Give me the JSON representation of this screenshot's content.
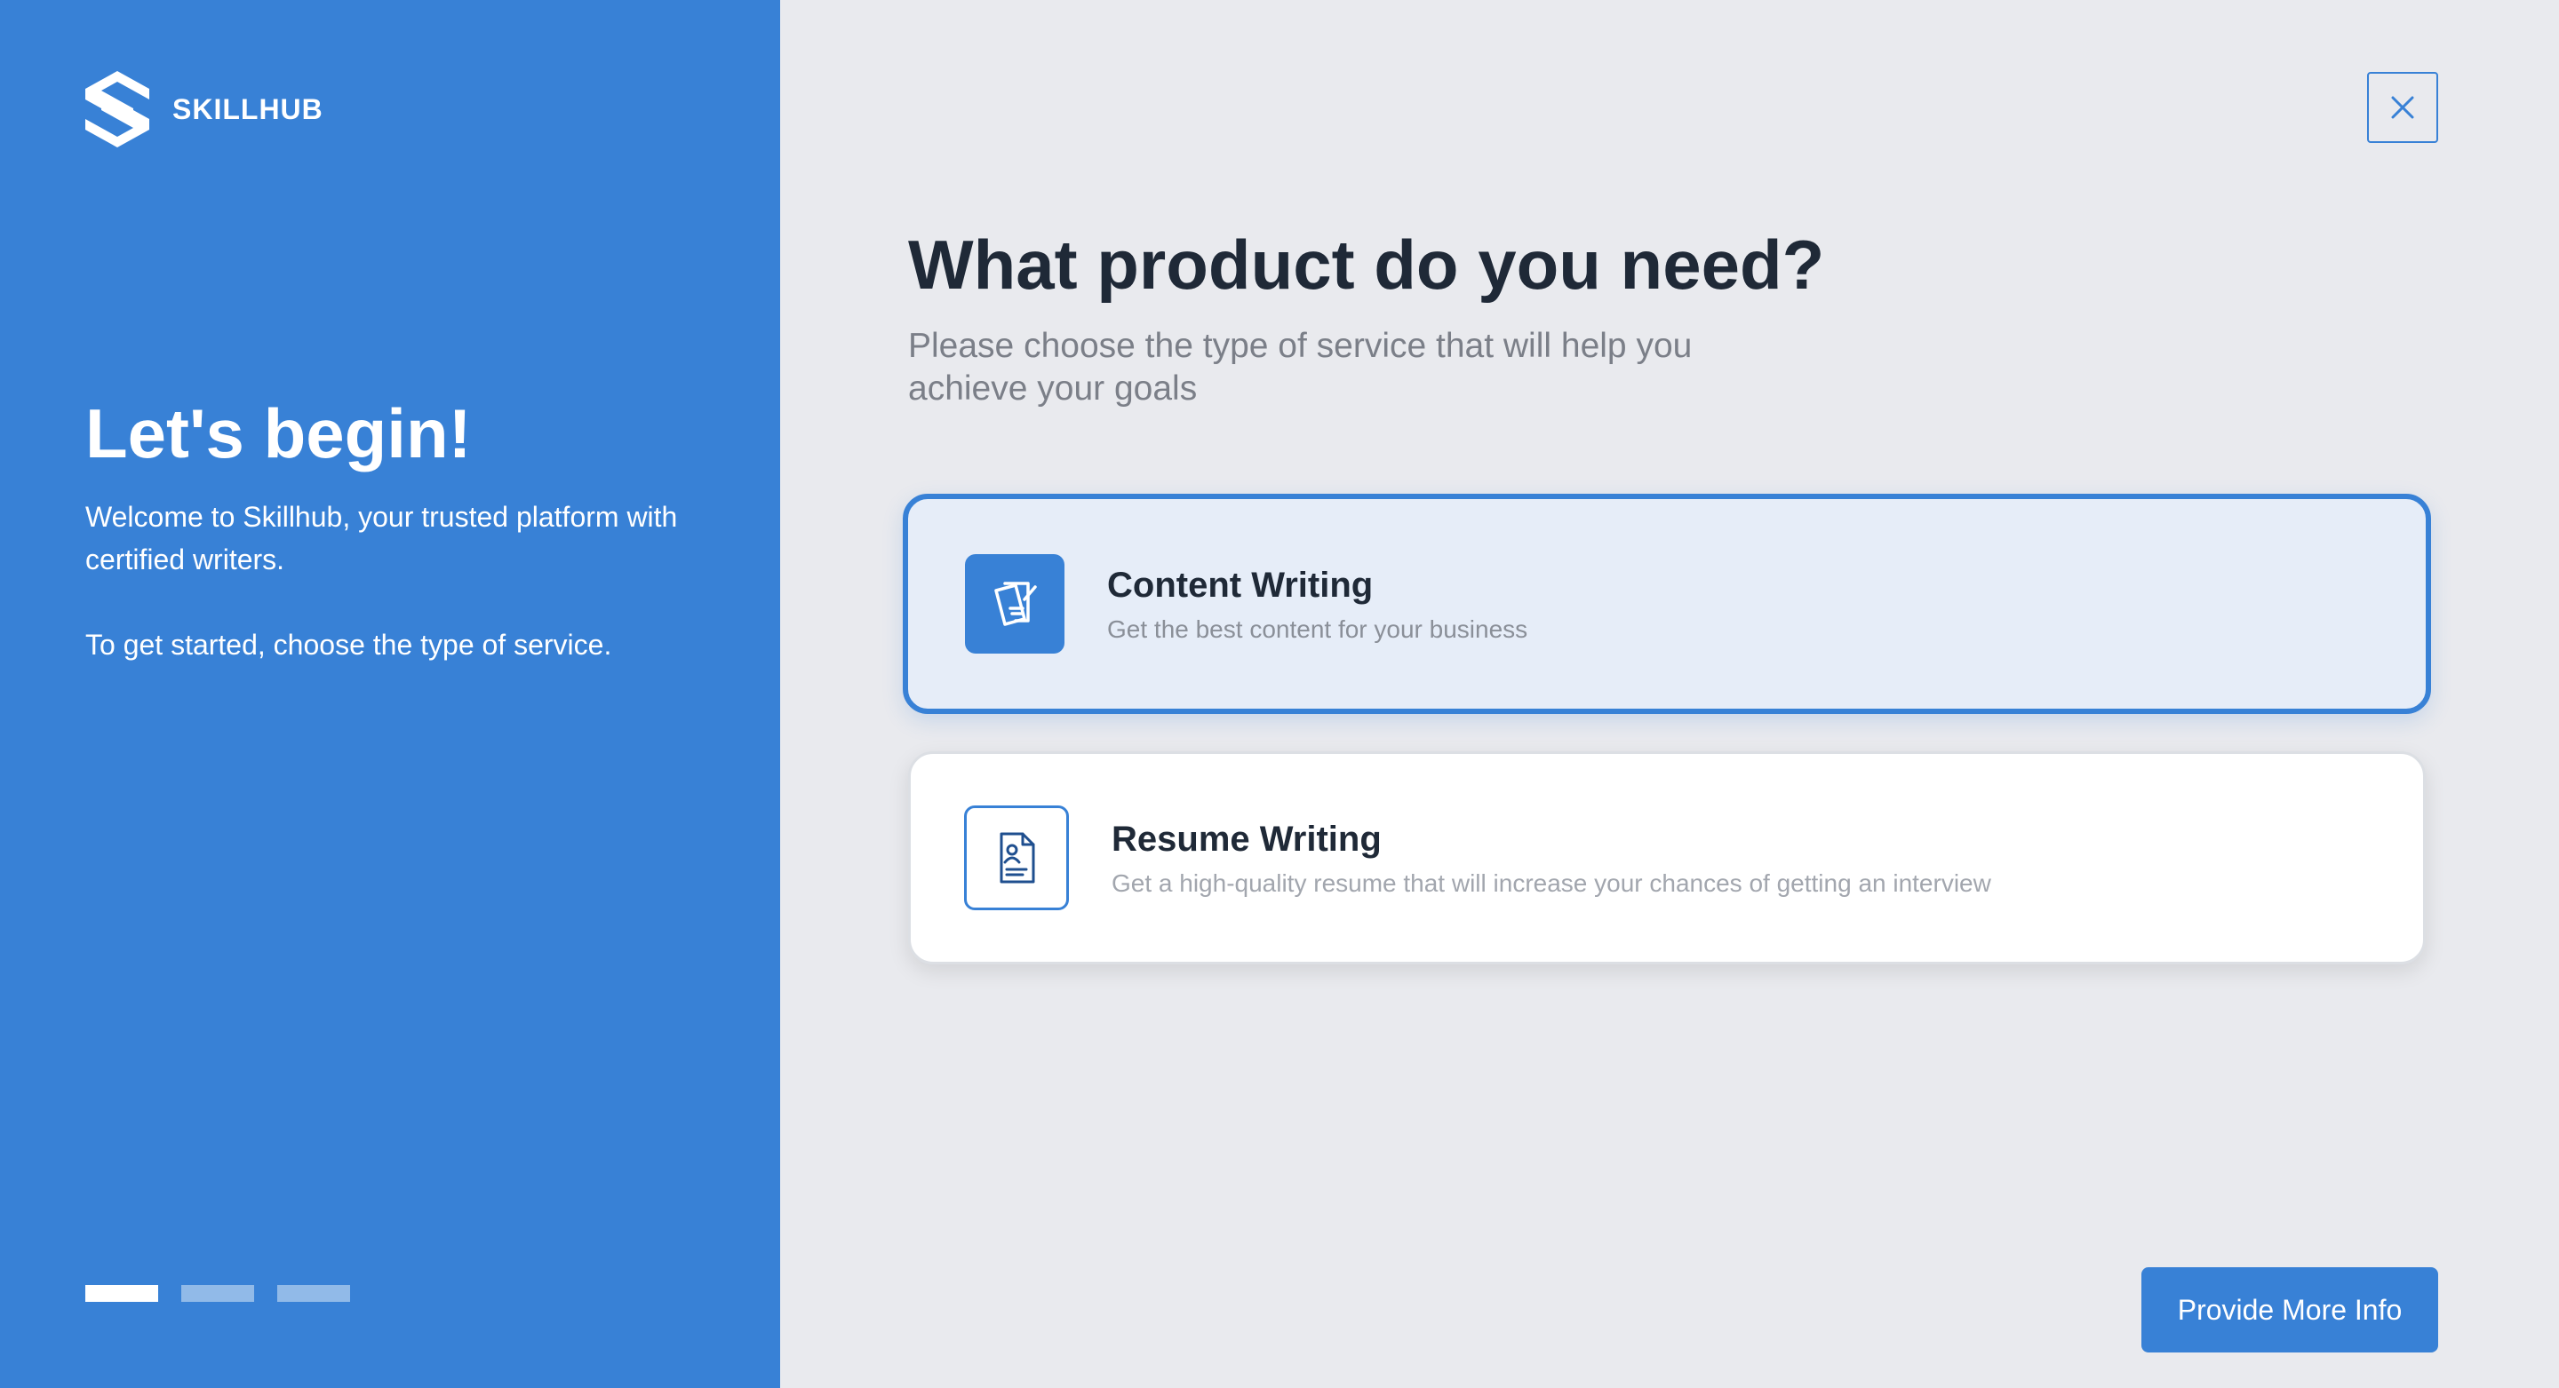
{
  "brand": {
    "name": "SKILLHUB",
    "logo_icon": "skillhub-logo-icon"
  },
  "intro": {
    "title": "Let's begin!",
    "text": "Welcome to Skillhub, your trusted platform with certified writers.",
    "instruction": "To get started, choose the type of service."
  },
  "progress": {
    "current_step": 1,
    "total_steps": 3
  },
  "close_button": {
    "icon": "close-icon"
  },
  "question": {
    "title": "What product do you need?",
    "subtitle": "Please choose the type of service that will help you achieve your goals"
  },
  "options": [
    {
      "title": "Content Writing",
      "description": "Get the best content for your business",
      "icon": "documents-pen-icon",
      "selected": true
    },
    {
      "title": "Resume Writing",
      "description": "Get a high-quality resume that will increase your chances of getting an interview",
      "icon": "resume-icon",
      "selected": false
    }
  ],
  "actions": {
    "primary_label": "Provide More Info"
  },
  "colors": {
    "accent": "#3881d6",
    "background": "#e9eaee",
    "selected_card": "#e6edf8",
    "heading": "#1f2937"
  }
}
